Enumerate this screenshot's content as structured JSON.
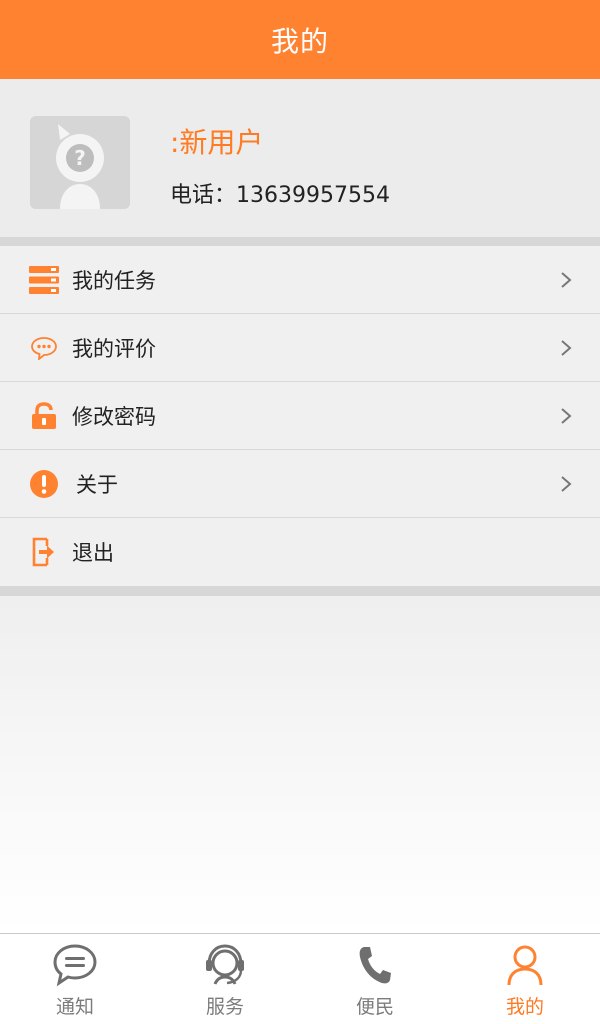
{
  "header": {
    "title": "我的"
  },
  "profile": {
    "username": ":新用户",
    "phone_label": "电话：",
    "phone_number": "13639957554"
  },
  "menu": {
    "items": [
      {
        "label": "我的任务",
        "icon": "task-list-icon"
      },
      {
        "label": "我的评价",
        "icon": "comment-icon"
      },
      {
        "label": "修改密码",
        "icon": "unlock-icon"
      },
      {
        "label": "关于",
        "icon": "info-alert-icon"
      },
      {
        "label": "退出",
        "icon": "logout-icon"
      }
    ]
  },
  "tabbar": {
    "tabs": [
      {
        "label": "通知",
        "icon": "chat-bubble-icon"
      },
      {
        "label": "服务",
        "icon": "headset-icon"
      },
      {
        "label": "便民",
        "icon": "phone-icon"
      },
      {
        "label": "我的",
        "icon": "person-icon",
        "active": true
      }
    ]
  },
  "colors": {
    "accent": "#ff8231",
    "accent_text": "#ff7a21",
    "icon_gray": "#7c7c7c"
  }
}
